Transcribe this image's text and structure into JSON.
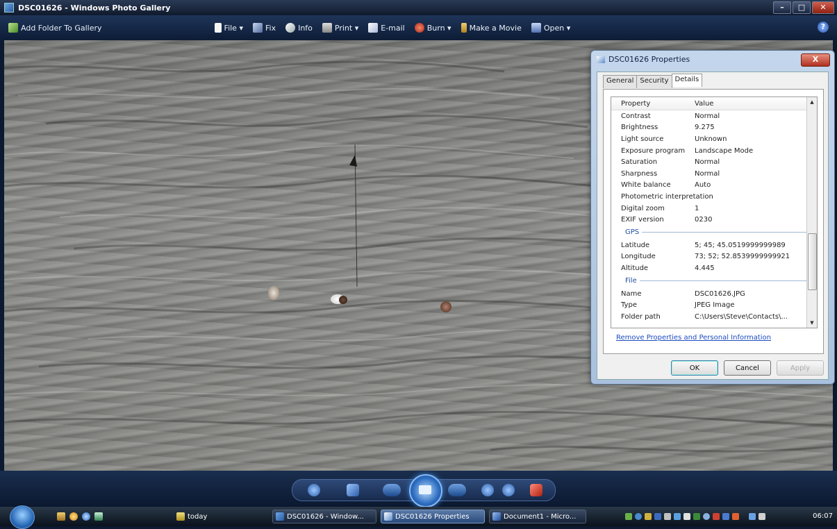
{
  "window": {
    "title": "DSC01626 - Windows Photo Gallery"
  },
  "toolbar": {
    "add_folder": "Add Folder To Gallery",
    "file": "File ▾",
    "fix": "Fix",
    "info": "Info",
    "print": "Print ▾",
    "email": "E-mail",
    "burn": "Burn ▾",
    "make_movie": "Make a Movie",
    "open": "Open ▾",
    "help": "?"
  },
  "dialog": {
    "title": "DSC01626 Properties",
    "close": "X",
    "tabs": [
      "General",
      "Security",
      "Details"
    ],
    "columns": {
      "property": "Property",
      "value": "Value"
    },
    "rows_top": [
      {
        "p": "Contrast",
        "v": "Normal"
      },
      {
        "p": "Brightness",
        "v": "9.275"
      },
      {
        "p": "Light source",
        "v": "Unknown"
      },
      {
        "p": "Exposure program",
        "v": "Landscape Mode"
      },
      {
        "p": "Saturation",
        "v": "Normal"
      },
      {
        "p": "Sharpness",
        "v": "Normal"
      },
      {
        "p": "White balance",
        "v": "Auto"
      },
      {
        "p": "Photometric interpretation",
        "v": ""
      },
      {
        "p": "Digital zoom",
        "v": "1"
      },
      {
        "p": "EXIF version",
        "v": "0230"
      }
    ],
    "group_gps": "GPS",
    "rows_gps": [
      {
        "p": "Latitude",
        "v": "5; 45; 45.0519999999989"
      },
      {
        "p": "Longitude",
        "v": "73; 52; 52.8539999999921"
      },
      {
        "p": "Altitude",
        "v": "4.445"
      }
    ],
    "group_file": "File",
    "rows_file": [
      {
        "p": "Name",
        "v": "DSC01626.JPG"
      },
      {
        "p": "Type",
        "v": "JPEG Image"
      },
      {
        "p": "Folder path",
        "v": "C:\\Users\\Steve\\Contacts\\..."
      }
    ],
    "remove_link": "Remove Properties and Personal Information",
    "ok": "OK",
    "cancel": "Cancel",
    "apply": "Apply"
  },
  "taskbar": {
    "tasks": [
      "today",
      "DSC01626 - Window...",
      "DSC01626 Properties",
      "Document1 - Micro..."
    ],
    "clock": "06:07"
  },
  "colors": {
    "toolbar_bg": "#1e3458",
    "link": "#1c4cc0",
    "group_header": "#2050a0"
  }
}
